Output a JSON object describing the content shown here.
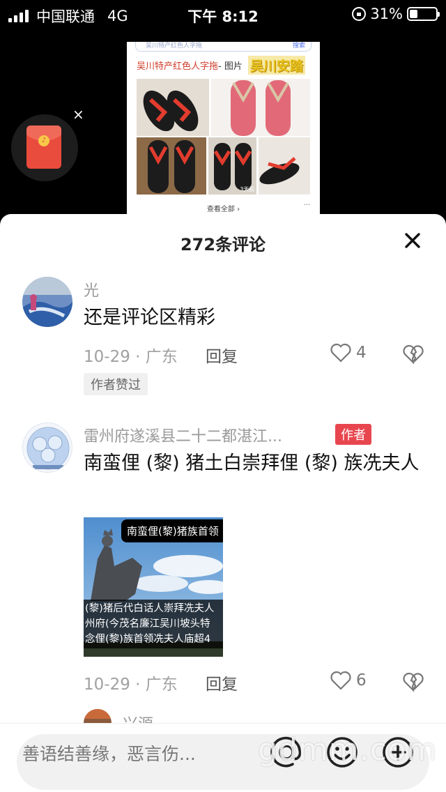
{
  "status_bar": {
    "carrier": "中国联通",
    "network": "4G",
    "time": "下午 8:12",
    "battery": "31%"
  },
  "video": {
    "search_text": "吴川特产红色人字拖",
    "search_button": "搜索",
    "result_title": "吴川特产红色人字拖",
    "result_title_suffix": " - 图片",
    "brand_overlay": "吴川安踏",
    "image_tag": "3天前",
    "view_all": "查看全部 ›",
    "more": "···"
  },
  "red_packet": {
    "close": "×"
  },
  "comments_panel": {
    "title": "272条评论",
    "comments": [
      {
        "user": "光",
        "text": "还是评论区精彩",
        "date_location": "10-29 · 广东",
        "reply": "回复",
        "likes": "4",
        "badge": "作者赞过"
      },
      {
        "user": "雷州府遂溪县二十二都湛江...",
        "author_badge": "作者",
        "text": "南蛮俚 (黎) 猪土白崇拜俚 (黎) 族冼夫人",
        "image_caption_top": "南蛮俚(黎)猪族首领",
        "image_caption_bottom": [
          "(黎)猪后代白话人崇拜冼夫人",
          "州府(今茂名廉江吴川坡头特",
          "念俚(黎)族首领冼夫人庙超4"
        ],
        "date_location": "10-29 · 广东",
        "reply": "回复",
        "likes": "6"
      },
      {
        "user": "兴源"
      }
    ]
  },
  "input_bar": {
    "placeholder": "善语结善缘，恶言伤..."
  },
  "watermark": "gdmm.com",
  "colors": {
    "accent_red": "#e8464f",
    "muted_text": "#a0a0a0"
  }
}
